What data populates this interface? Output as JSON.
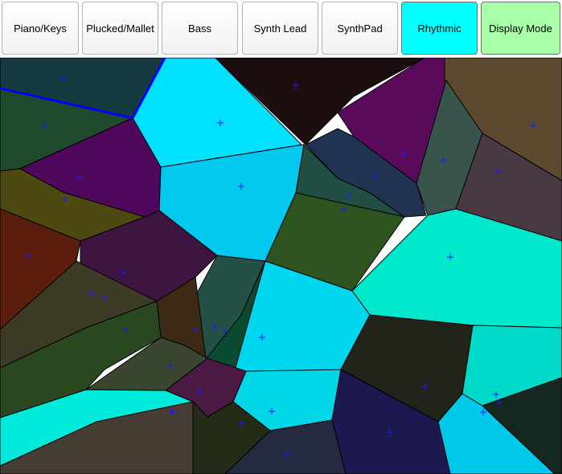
{
  "toolbar": {
    "buttons": [
      {
        "label": "Piano/Keys",
        "state": "normal"
      },
      {
        "label": "Plucked/Mallet",
        "state": "normal"
      },
      {
        "label": "Bass",
        "state": "normal"
      },
      {
        "label": "Synth Lead",
        "state": "normal"
      },
      {
        "label": "SynthPad",
        "state": "normal"
      },
      {
        "label": "Rhythmic",
        "state": "active"
      },
      {
        "label": "Display Mode",
        "state": "toggle"
      }
    ]
  },
  "colors": {
    "active_button": "#00ffff",
    "toggle_button": "#a8ffa8",
    "cell_border": "#000000",
    "site_marker": "#1a1aff",
    "highlight_border": "#0000ff",
    "cells": [
      "#173a40",
      "#00e0ff",
      "#1c0e0e",
      "#5a0a5a",
      "#5c4930",
      "#1f4a2c",
      "#50085c",
      "#00c8ee",
      "#213350",
      "#224f43",
      "#38544d",
      "#493943",
      "#4c4a10",
      "#2e5520",
      "#00e8cc",
      "#5c1e0c",
      "#3e1440",
      "#245045",
      "#00d6ee",
      "#3c2a14",
      "#3c3a24",
      "#0a4a30",
      "#2a4820",
      "#20241a",
      "#00d8c8",
      "#3a4630",
      "#4a1a44",
      "#00eadc",
      "#00d6e6",
      "#1c1850",
      "#00c8e8",
      "#152820",
      "#232c17",
      "#262a40",
      "#453d34",
      "#502814"
    ]
  }
}
